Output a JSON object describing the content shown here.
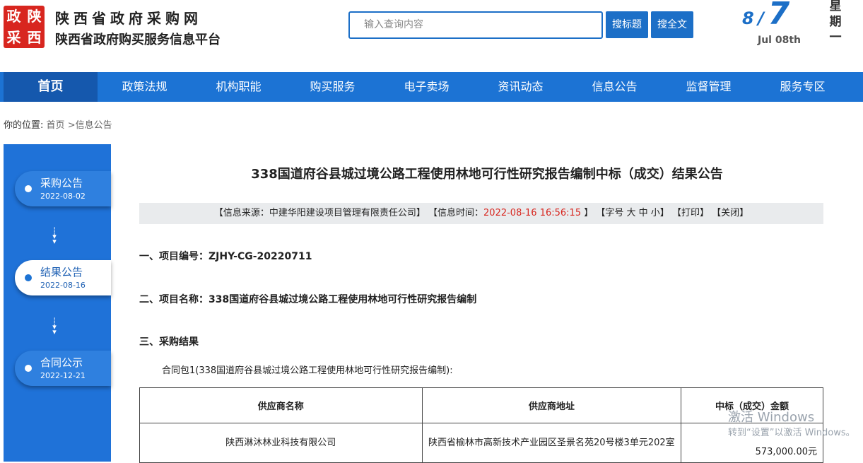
{
  "header": {
    "logo_chars": [
      "政",
      "陕",
      "采",
      "西"
    ],
    "site_name": "陕西省政府采购网",
    "site_sub": "陕西省政府购买服务信息平台",
    "search_placeholder": "输入查询内容",
    "search_title_button": "搜标题",
    "search_full_button": "搜全文",
    "date_month": "8",
    "date_slash": "/",
    "date_day": "7",
    "date_en": "Jul 08th",
    "weekday": [
      "星",
      "期",
      "一"
    ]
  },
  "nav": {
    "items": [
      "首页",
      "政策法规",
      "机构职能",
      "购买服务",
      "电子卖场",
      "资讯动态",
      "信息公告",
      "监督管理",
      "服务专区"
    ],
    "active_index": 0
  },
  "breadcrumb": {
    "prefix": "你的位置:",
    "home": "首页",
    "current": ">信息公告"
  },
  "sidebar": {
    "steps": [
      {
        "name": "采购公告",
        "date": "2022-08-02",
        "active": false
      },
      {
        "name": "结果公告",
        "date": "2022-08-16",
        "active": true
      },
      {
        "name": "合同公示",
        "date": "2022-12-21",
        "active": false
      }
    ]
  },
  "article": {
    "title": "338国道府谷县城过境公路工程使用林地可行性研究报告编制中标（成交）结果公告",
    "info": {
      "source": "【信息来源：中建华阳建设项目管理有限责任公司】",
      "time_label": "【信息时间：",
      "time_value": "2022-08-16 16:56:15",
      "time_close": "】",
      "font_size": "【字号 大 中 小】",
      "print": "【打印】",
      "close": "【关闭】"
    },
    "sections": [
      "一、项目编号：ZJHY-CG-20220711",
      "二、项目名称：338国道府谷县城过境公路工程使用林地可行性研究报告编制",
      "三、采购结果"
    ],
    "package_label": "合同包1(338国道府谷县城过境公路工程使用林地可行性研究报告编制):",
    "table": {
      "headers": [
        "供应商名称",
        "供应商地址",
        "中标（成交）金额"
      ],
      "rows": [
        [
          "陕西淋沐林业科技有限公司",
          "陕西省榆林市高新技术产业园区圣景名苑20号楼3单元202室",
          "573,000.00元"
        ]
      ]
    }
  },
  "watermark": {
    "title": "激活 Windows",
    "subtitle": "转到“设置”以激活 Windows。"
  }
}
